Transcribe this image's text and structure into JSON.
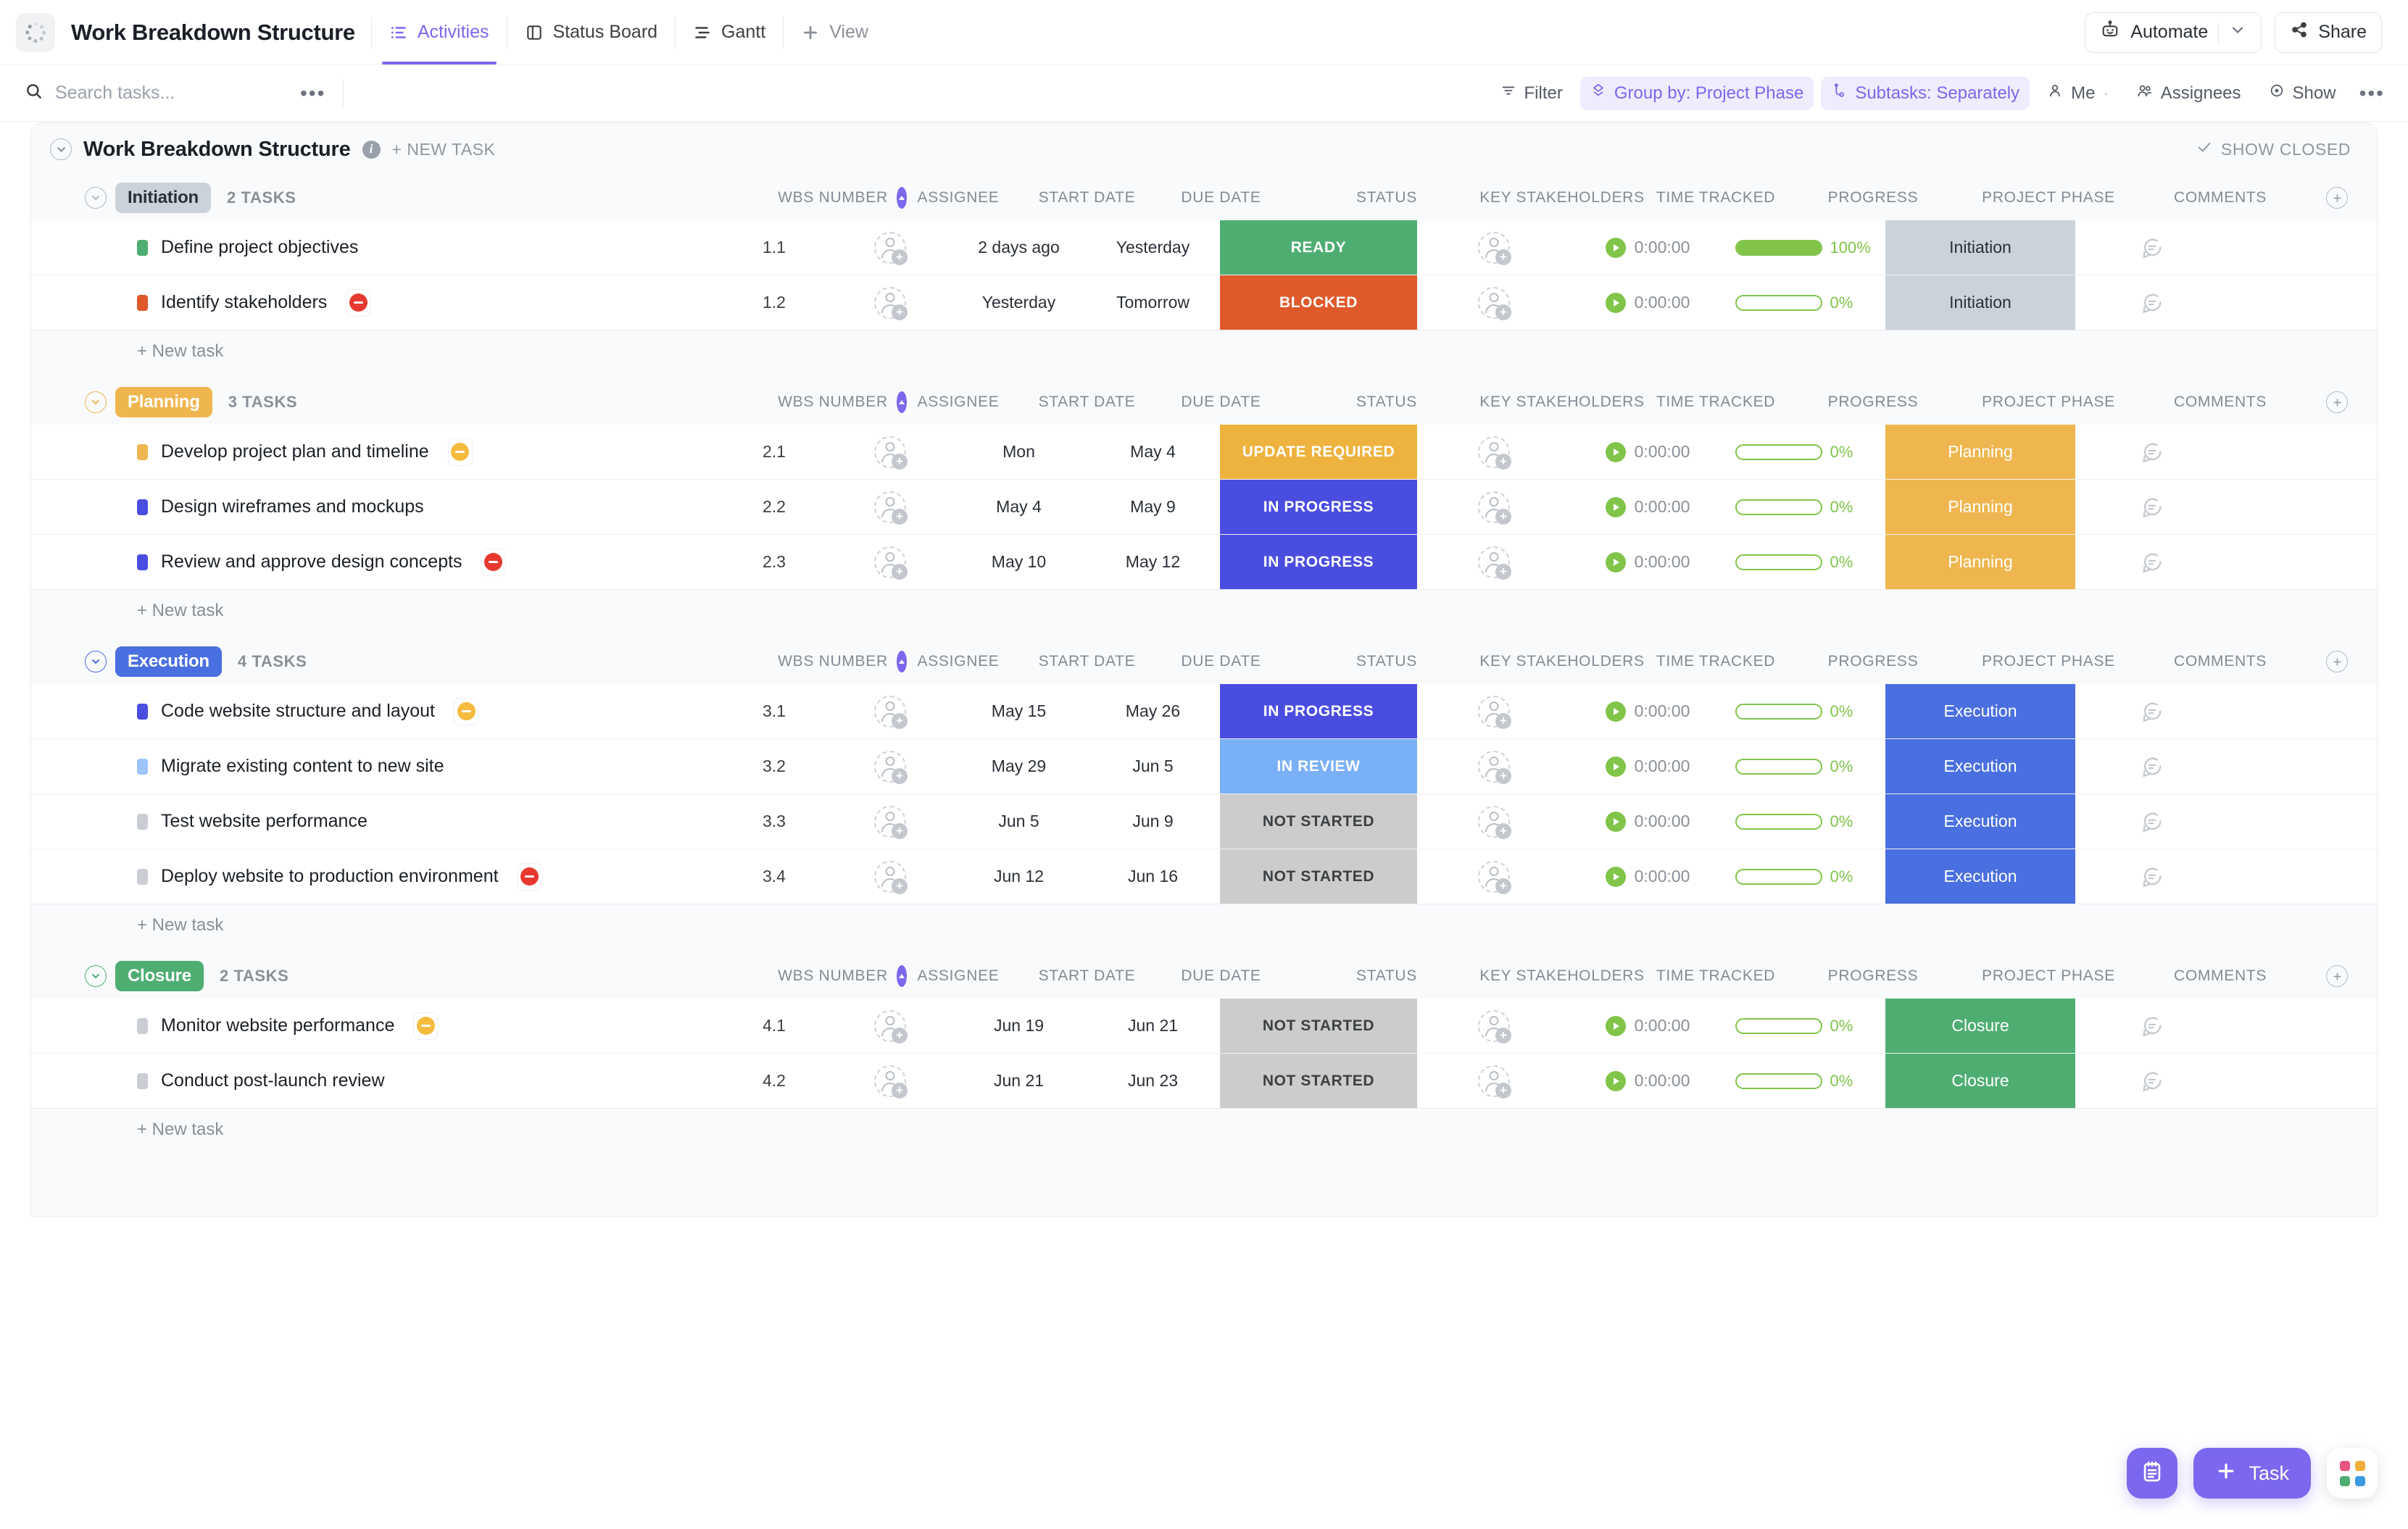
{
  "header": {
    "app_title": "Work Breakdown Structure",
    "logo_icon": "spinner-dots-icon",
    "tabs": [
      {
        "label": "Activities",
        "icon": "list-icon",
        "active": true
      },
      {
        "label": "Status Board",
        "icon": "board-icon",
        "active": false
      },
      {
        "label": "Gantt",
        "icon": "gantt-icon",
        "active": false
      },
      {
        "label": "View",
        "icon": "plus-icon",
        "active": false
      }
    ],
    "automate_label": "Automate",
    "automate_icon": "robot-icon",
    "automate_caret_icon": "chevron-down-icon",
    "share_label": "Share",
    "share_icon": "share-icon"
  },
  "toolbar": {
    "search_placeholder": "Search tasks...",
    "search_value": "",
    "search_icon": "search-icon",
    "more_icon": "ellipsis-icon",
    "chips": [
      {
        "label": "Filter",
        "icon": "filter-icon",
        "highlight": false
      },
      {
        "label": "Group by: Project Phase",
        "icon": "group-icon",
        "highlight": true
      },
      {
        "label": "Subtasks: Separately",
        "icon": "subtask-icon",
        "highlight": true
      },
      {
        "label": "Me",
        "icon": "person-icon",
        "highlight": false
      },
      {
        "label": "Assignees",
        "icon": "people-icon",
        "highlight": false
      },
      {
        "label": "Show",
        "icon": "eye-icon",
        "highlight": false
      }
    ],
    "overflow_icon": "ellipsis-icon"
  },
  "panel": {
    "title": "Work Breakdown Structure",
    "info_icon": "info-icon",
    "collapse_icon": "chevron-down-circle-icon",
    "new_task_label": "+ NEW TASK",
    "show_closed_label": "SHOW CLOSED",
    "show_closed_icon": "check-icon",
    "new_task_row_label": "+ New task"
  },
  "columns": [
    {
      "key": "wbs",
      "label": "WBS NUMBER",
      "sorted": true,
      "sort_icon": "sort-asc-icon"
    },
    {
      "key": "assignee",
      "label": "ASSIGNEE"
    },
    {
      "key": "start",
      "label": "START DATE"
    },
    {
      "key": "due",
      "label": "DUE DATE"
    },
    {
      "key": "status",
      "label": "STATUS"
    },
    {
      "key": "stakeholders",
      "label": "KEY STAKEHOLDERS"
    },
    {
      "key": "time",
      "label": "TIME TRACKED"
    },
    {
      "key": "progress",
      "label": "PROGRESS"
    },
    {
      "key": "phase",
      "label": "PROJECT PHASE"
    },
    {
      "key": "comments",
      "label": "COMMENTS"
    }
  ],
  "add_column_icon": "plus-circle-icon",
  "colors": {
    "accent": "#7b68ee",
    "ready": "#4eae72",
    "blocked": "#e0592a",
    "update_required": "#eeb33f",
    "in_progress": "#4a4ee0",
    "in_review": "#7ab0f7",
    "not_started": "#cccccc",
    "phase_initiation": "#ccd2d9",
    "phase_planning": "#efb64f",
    "phase_execution": "#4a6fe0",
    "phase_closure": "#4eae72",
    "progress_green": "#80c449"
  },
  "groups": [
    {
      "name": "Initiation",
      "count_label": "2 TASKS",
      "pill_bg": "#ccd2d9",
      "pill_fg": "#2b2f38",
      "chev_color": "#b4b9c1",
      "tasks": [
        {
          "title": "Define project objectives",
          "square_color": "#4eae72",
          "priority_flag": null,
          "wbs": "1.1",
          "start": "2 days ago",
          "due": "Yesterday",
          "status": "READY",
          "status_bg": "#4eae72",
          "status_fg": "#ffffff",
          "time": "0:00:00",
          "progress_pct": 100,
          "progress_label": "100%",
          "phase": "Initiation",
          "phase_bg": "#ccd2d9",
          "phase_fg": "#2b2f38"
        },
        {
          "title": "Identify stakeholders",
          "square_color": "#e0592a",
          "priority_flag": "#e8392f",
          "wbs": "1.2",
          "start": "Yesterday",
          "due": "Tomorrow",
          "status": "BLOCKED",
          "status_bg": "#e0592a",
          "status_fg": "#ffffff",
          "time": "0:00:00",
          "progress_pct": 0,
          "progress_label": "0%",
          "phase": "Initiation",
          "phase_bg": "#ccd2d9",
          "phase_fg": "#2b2f38"
        }
      ]
    },
    {
      "name": "Planning",
      "count_label": "3 TASKS",
      "pill_bg": "#efb64f",
      "pill_fg": "#ffffff",
      "chev_color": "#efb64f",
      "tasks": [
        {
          "title": "Develop project plan and timeline",
          "square_color": "#efb64f",
          "priority_flag": "#f5bb3d",
          "wbs": "2.1",
          "start": "Mon",
          "due": "May 4",
          "status": "UPDATE REQUIRED",
          "status_bg": "#eeb33f",
          "status_fg": "#ffffff",
          "time": "0:00:00",
          "progress_pct": 0,
          "progress_label": "0%",
          "phase": "Planning",
          "phase_bg": "#efb64f",
          "phase_fg": "#ffffff"
        },
        {
          "title": "Design wireframes and mockups",
          "square_color": "#4a4ee0",
          "priority_flag": null,
          "wbs": "2.2",
          "start": "May 4",
          "due": "May 9",
          "status": "IN PROGRESS",
          "status_bg": "#4a4ee0",
          "status_fg": "#ffffff",
          "time": "0:00:00",
          "progress_pct": 0,
          "progress_label": "0%",
          "phase": "Planning",
          "phase_bg": "#efb64f",
          "phase_fg": "#ffffff"
        },
        {
          "title": "Review and approve design concepts",
          "square_color": "#4a4ee0",
          "priority_flag": "#e8392f",
          "wbs": "2.3",
          "start": "May 10",
          "due": "May 12",
          "status": "IN PROGRESS",
          "status_bg": "#4a4ee0",
          "status_fg": "#ffffff",
          "time": "0:00:00",
          "progress_pct": 0,
          "progress_label": "0%",
          "phase": "Planning",
          "phase_bg": "#efb64f",
          "phase_fg": "#ffffff"
        }
      ]
    },
    {
      "name": "Execution",
      "count_label": "4 TASKS",
      "pill_bg": "#4a6fe0",
      "pill_fg": "#ffffff",
      "chev_color": "#4a6fe0",
      "tasks": [
        {
          "title": "Code website structure and layout",
          "square_color": "#4a4ee0",
          "priority_flag": "#f5bb3d",
          "wbs": "3.1",
          "start": "May 15",
          "due": "May 26",
          "status": "IN PROGRESS",
          "status_bg": "#4a4ee0",
          "status_fg": "#ffffff",
          "time": "0:00:00",
          "progress_pct": 0,
          "progress_label": "0%",
          "phase": "Execution",
          "phase_bg": "#4a6fe0",
          "phase_fg": "#ffffff"
        },
        {
          "title": "Migrate existing content to new site",
          "square_color": "#9cc3fa",
          "priority_flag": null,
          "wbs": "3.2",
          "start": "May 29",
          "due": "Jun 5",
          "status": "IN REVIEW",
          "status_bg": "#7ab0f7",
          "status_fg": "#ffffff",
          "time": "0:00:00",
          "progress_pct": 0,
          "progress_label": "0%",
          "phase": "Execution",
          "phase_bg": "#4a6fe0",
          "phase_fg": "#ffffff"
        },
        {
          "title": "Test website performance",
          "square_color": "#cacdd3",
          "priority_flag": null,
          "wbs": "3.3",
          "start": "Jun 5",
          "due": "Jun 9",
          "status": "NOT STARTED",
          "status_bg": "#cccccc",
          "status_fg": "#3c4043",
          "time": "0:00:00",
          "progress_pct": 0,
          "progress_label": "0%",
          "phase": "Execution",
          "phase_bg": "#4a6fe0",
          "phase_fg": "#ffffff"
        },
        {
          "title": "Deploy website to production environment",
          "square_color": "#cacdd3",
          "priority_flag": "#e8392f",
          "wbs": "3.4",
          "start": "Jun 12",
          "due": "Jun 16",
          "status": "NOT STARTED",
          "status_bg": "#cccccc",
          "status_fg": "#3c4043",
          "time": "0:00:00",
          "progress_pct": 0,
          "progress_label": "0%",
          "phase": "Execution",
          "phase_bg": "#4a6fe0",
          "phase_fg": "#ffffff"
        }
      ]
    },
    {
      "name": "Closure",
      "count_label": "2 TASKS",
      "pill_bg": "#4eae72",
      "pill_fg": "#ffffff",
      "chev_color": "#4eae72",
      "tasks": [
        {
          "title": "Monitor website performance",
          "square_color": "#cacdd3",
          "priority_flag": "#f5bb3d",
          "wbs": "4.1",
          "start": "Jun 19",
          "due": "Jun 21",
          "status": "NOT STARTED",
          "status_bg": "#cccccc",
          "status_fg": "#3c4043",
          "time": "0:00:00",
          "progress_pct": 0,
          "progress_label": "0%",
          "phase": "Closure",
          "phase_bg": "#4eae72",
          "phase_fg": "#ffffff"
        },
        {
          "title": "Conduct post-launch review",
          "square_color": "#cacdd3",
          "priority_flag": null,
          "wbs": "4.2",
          "start": "Jun 21",
          "due": "Jun 23",
          "status": "NOT STARTED",
          "status_bg": "#cccccc",
          "status_fg": "#3c4043",
          "time": "0:00:00",
          "progress_pct": 0,
          "progress_label": "0%",
          "phase": "Closure",
          "phase_bg": "#4eae72",
          "phase_fg": "#ffffff"
        }
      ]
    }
  ],
  "fabs": {
    "note_icon": "notepad-icon",
    "task_label": "Task",
    "task_icon": "plus-icon",
    "apps_icon": "apps-grid-icon"
  }
}
